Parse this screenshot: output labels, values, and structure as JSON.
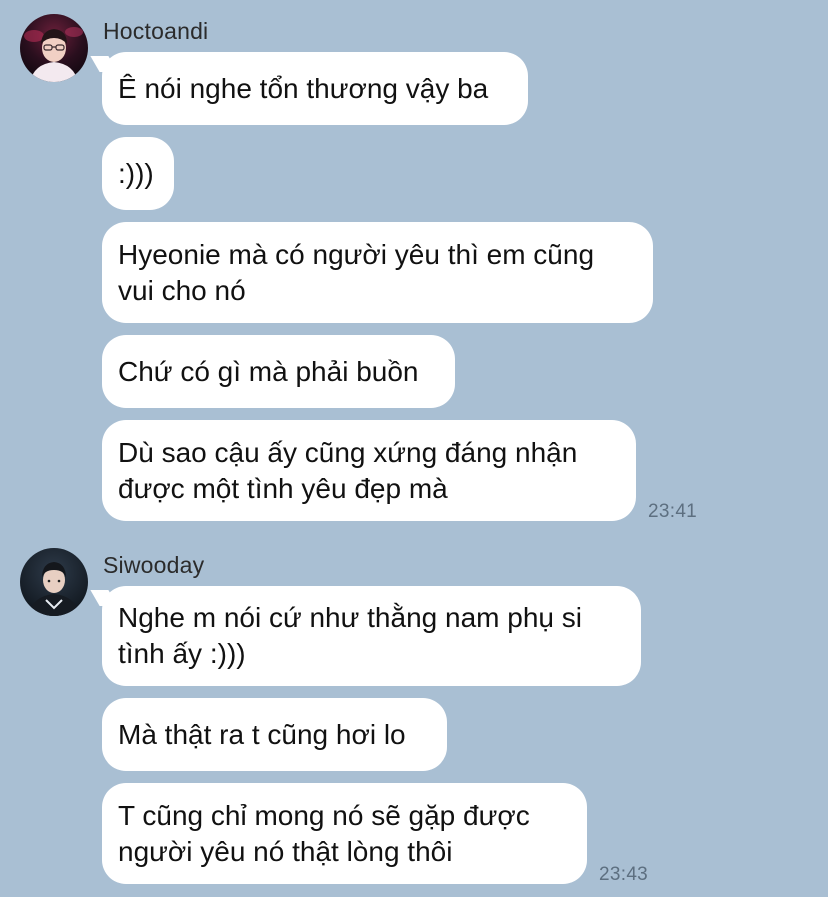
{
  "groups": [
    {
      "sender": "Hoctoandi",
      "avatar": "user-avatar-hoctoandi",
      "messages": [
        "Ê nói nghe tổn thương vậy ba",
        ":)))",
        "Hyeonie mà có người yêu thì em cũng\nvui cho nó",
        "Chứ có gì mà phải buồn",
        "Dù sao cậu ấy cũng xứng đáng nhận\nđược một tình yêu đẹp mà"
      ],
      "time": "23:41"
    },
    {
      "sender": "Siwooday",
      "avatar": "user-avatar-siwooday",
      "messages": [
        "Nghe m nói cứ như thằng nam phụ si\ntình ấy :)))",
        "Mà thật ra t cũng hơi lo",
        "T cũng chỉ mong nó sẽ gặp được\nngười yêu nó thật lòng thôi"
      ],
      "time": "23:43"
    }
  ],
  "colors": {
    "background": "#a9bfd3",
    "bubble": "#ffffff",
    "text": "#111111",
    "timestamp": "#5d6f80"
  }
}
